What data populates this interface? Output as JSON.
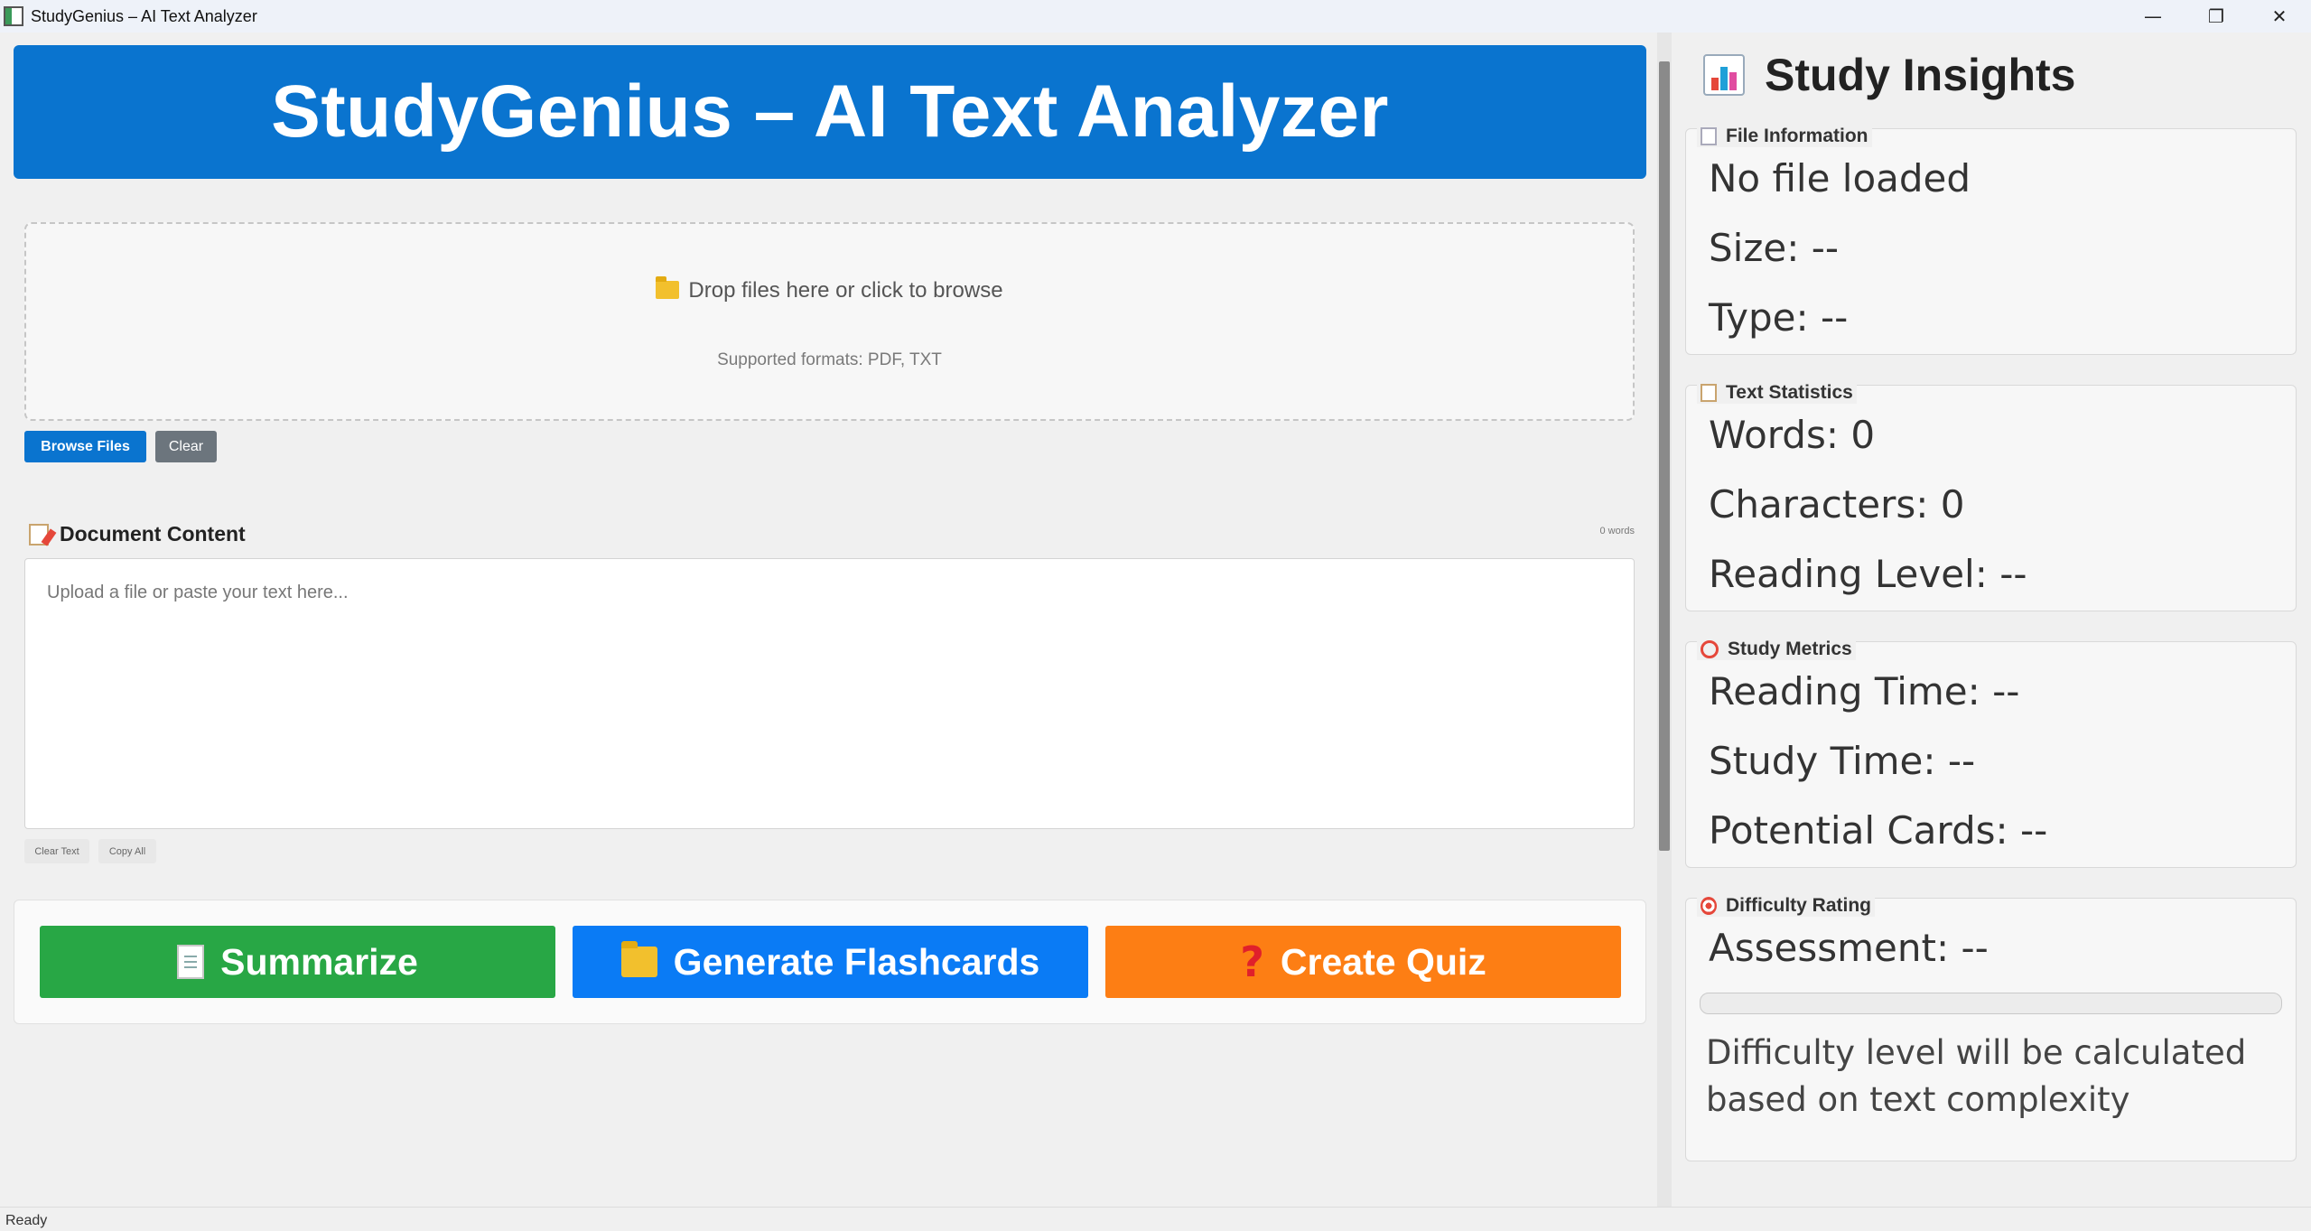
{
  "window": {
    "title": "StudyGenius – AI Text Analyzer",
    "minimize_glyph": "—",
    "restore_glyph": "❐",
    "close_glyph": "✕"
  },
  "header": {
    "title": "StudyGenius – AI Text Analyzer"
  },
  "upload": {
    "drop_text": "Drop files here or click to browse",
    "drop_icon": "folder-icon",
    "supported": "Supported formats: PDF, TXT",
    "browse_label": "Browse Files",
    "clear_label": "Clear"
  },
  "document": {
    "title": "Document Content",
    "word_count": "0 words",
    "placeholder": "Upload a file or paste your text here...",
    "clear_text_label": "Clear Text",
    "copy_all_label": "Copy All"
  },
  "actions": {
    "summarize": "Summarize",
    "flashcards": "Generate Flashcards",
    "quiz": "Create Quiz",
    "quiz_icon_glyph": "?"
  },
  "insights": {
    "title": "Study Insights",
    "file_info": {
      "label": "File Information",
      "name": "No file loaded",
      "size": "Size: --",
      "type": "Type: --"
    },
    "text_stats": {
      "label": "Text Statistics",
      "words": "Words: 0",
      "characters": "Characters: 0",
      "reading_level": "Reading Level: --"
    },
    "study_metrics": {
      "label": "Study Metrics",
      "reading_time": "Reading Time: --",
      "study_time": "Study Time: --",
      "potential_cards": "Potential Cards: --"
    },
    "difficulty": {
      "label": "Difficulty Rating",
      "assessment": "Assessment: --",
      "progress": 0,
      "note": "Difficulty level will be calculated based on text complexity"
    }
  },
  "status": {
    "text": "Ready"
  },
  "colors": {
    "primary": "#0a74cf",
    "summarize": "#28a745",
    "flashcards": "#0a7bf5",
    "quiz": "#fd7e14",
    "clear": "#6c757d"
  }
}
